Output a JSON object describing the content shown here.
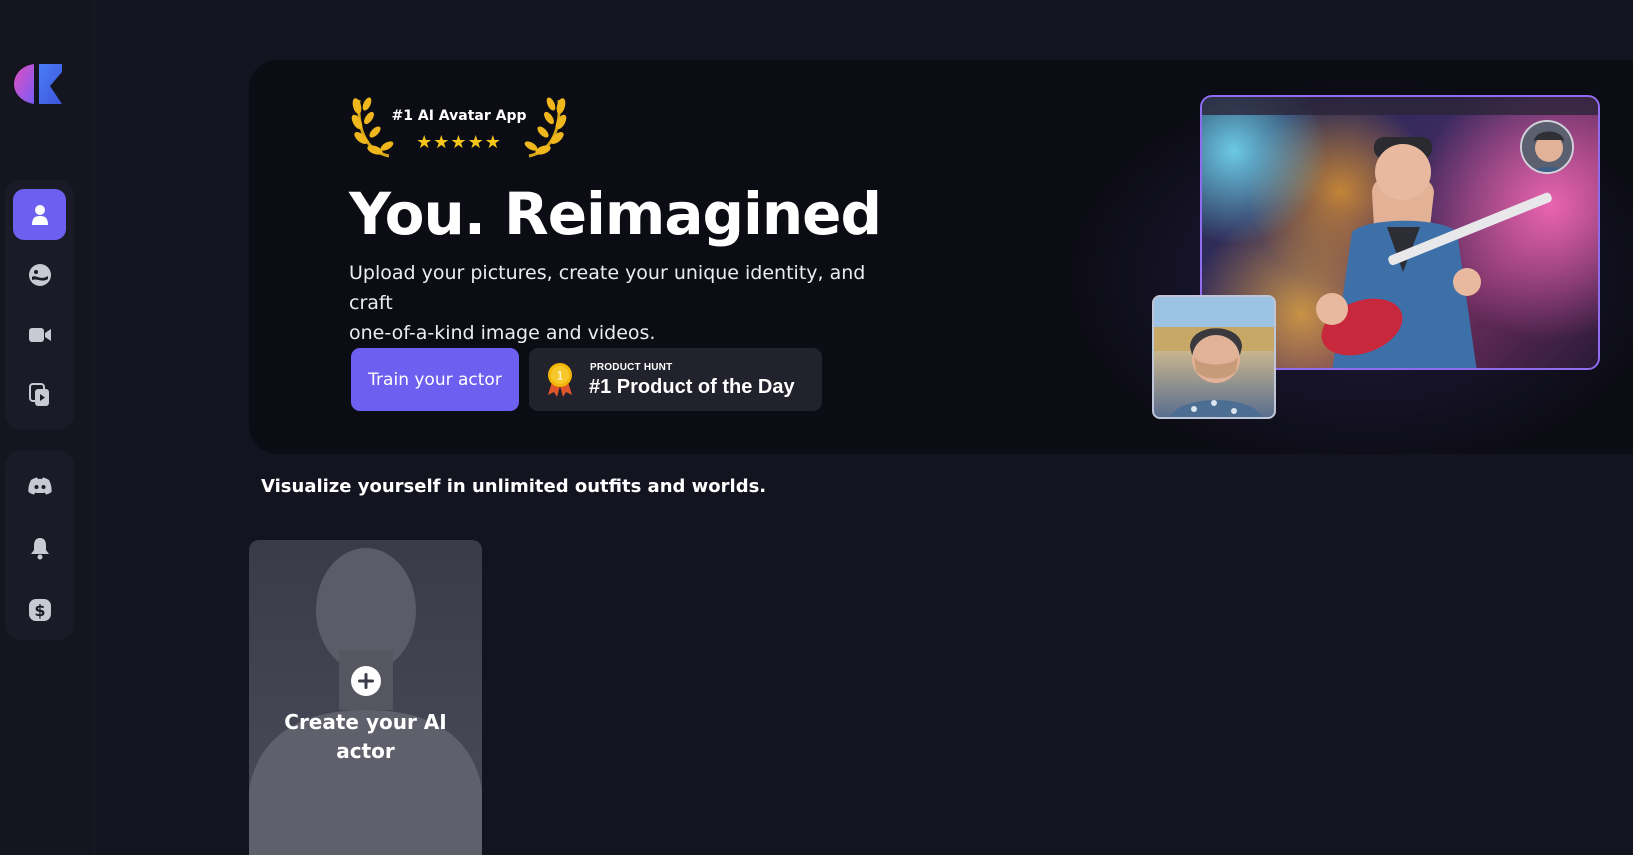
{
  "sidebar": {
    "logo": "app-logo",
    "top_items": [
      {
        "icon": "person-icon",
        "active": true
      },
      {
        "icon": "face-swap-icon",
        "active": false
      },
      {
        "icon": "video-camera-icon",
        "active": false
      },
      {
        "icon": "video-copy-icon",
        "active": false
      }
    ],
    "bottom_items": [
      {
        "icon": "discord-icon"
      },
      {
        "icon": "bell-icon"
      },
      {
        "icon": "dollar-icon"
      }
    ]
  },
  "hero": {
    "badge_label": "#1 AI Avatar App",
    "badge_stars": "★★★★★",
    "title": "You. Reimagined",
    "subtitle_line1": "Upload your pictures, create your unique identity, and craft",
    "subtitle_line2": " one-of-a-kind image and videos.",
    "train_button": "Train your actor",
    "product_hunt_small": "PRODUCT HUNT",
    "product_hunt_big": "#1 Product of the Day",
    "medal_number": "1"
  },
  "section": {
    "heading": "Visualize yourself in unlimited outfits and worlds."
  },
  "actor_card": {
    "label_line1": "Create your AI",
    "label_line2": "actor"
  },
  "colors": {
    "accent": "#6d5ff0",
    "background": "#13141f",
    "hero_bg": "#0c0c14",
    "star": "#f5c518"
  }
}
